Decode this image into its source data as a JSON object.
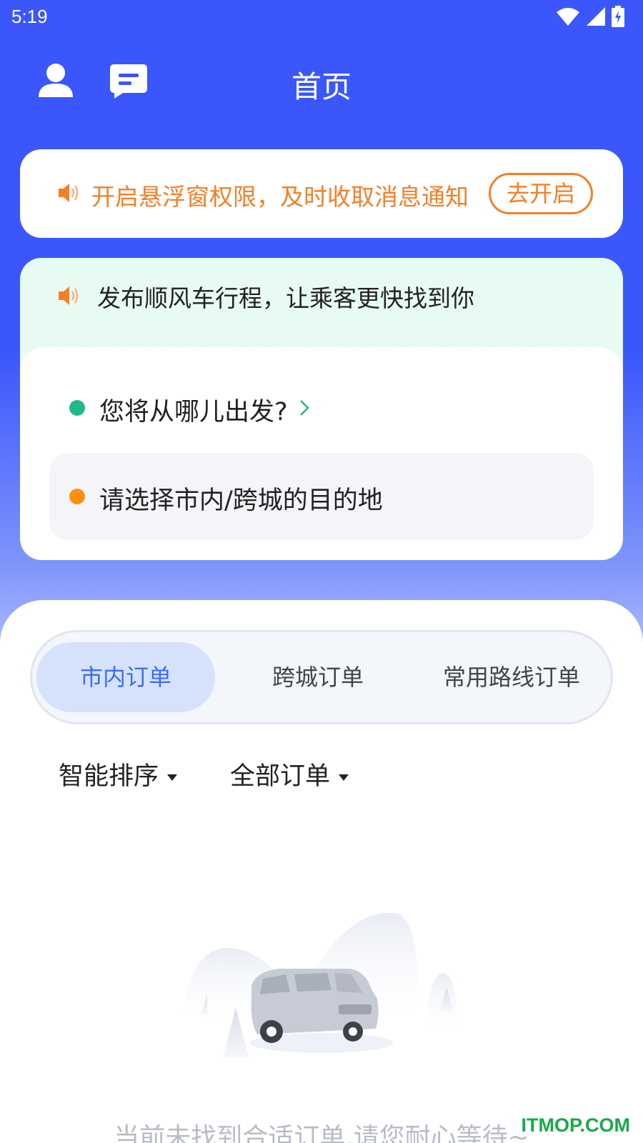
{
  "status_bar": {
    "time": "5:19"
  },
  "header": {
    "title": "首页",
    "profile_icon": "person-icon",
    "message_icon": "message-icon"
  },
  "notice": {
    "text": "开启悬浮窗权限，及时收取消息通知",
    "button_label": "去开启",
    "icon": "speaker-icon",
    "accent_color": "#f57f25"
  },
  "publish": {
    "text": "发布顺风车行程，让乘客更快找到你",
    "icon": "speaker-icon",
    "start_placeholder": "您将从哪儿出发?",
    "start_dot_color": "#1fb98a",
    "end_placeholder": "请选择市内/跨城的目的地",
    "end_dot_color": "#ff8f0f"
  },
  "tabs": [
    {
      "label": "市内订单",
      "active": true
    },
    {
      "label": "跨城订单",
      "active": false
    },
    {
      "label": "常用路线订单",
      "active": false
    }
  ],
  "filters": {
    "sort_label": "智能排序",
    "order_type_label": "全部订单"
  },
  "empty_state": {
    "illustration": "van-in-forest-illustration",
    "message": "当前未找到合适订单,请您耐心等待~"
  },
  "watermark": "ITMOP.COM",
  "colors": {
    "brand_blue": "#3b57fb",
    "active_tab_text": "#3d6ef0",
    "active_tab_bg": "#d6e2fc"
  }
}
